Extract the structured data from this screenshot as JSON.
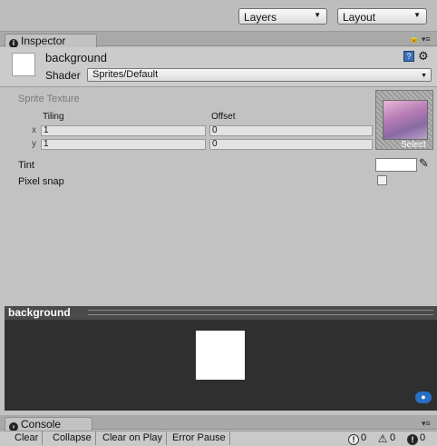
{
  "toolbar": {
    "layers_label": "Layers",
    "layout_label": "Layout"
  },
  "inspector": {
    "tab_label": "Inspector",
    "material_name": "background",
    "shader_label": "Shader",
    "shader_value": "Sprites/Default",
    "section_title": "Sprite Texture",
    "tiling_label": "Tiling",
    "offset_label": "Offset",
    "x_label": "x",
    "y_label": "y",
    "tiling_x": "1",
    "tiling_y": "1",
    "offset_x": "0",
    "offset_y": "0",
    "select_label": "Select",
    "tint_label": "Tint",
    "pixel_snap_label": "Pixel snap",
    "tint_color": "#ffffff"
  },
  "preview": {
    "title": "background"
  },
  "console": {
    "tab_label": "Console",
    "buttons": [
      "Clear",
      "Collapse",
      "Clear on Play",
      "Error Pause"
    ],
    "info_count": "0",
    "warning_count": "0",
    "error_count": "0"
  },
  "icons": [
    "dropdown-arrow",
    "info-icon",
    "lock-icon",
    "pane-menu-icon",
    "help-book-icon",
    "gear-icon",
    "eyedropper-icon",
    "tag-icon",
    "warning-icon",
    "error-icon"
  ]
}
